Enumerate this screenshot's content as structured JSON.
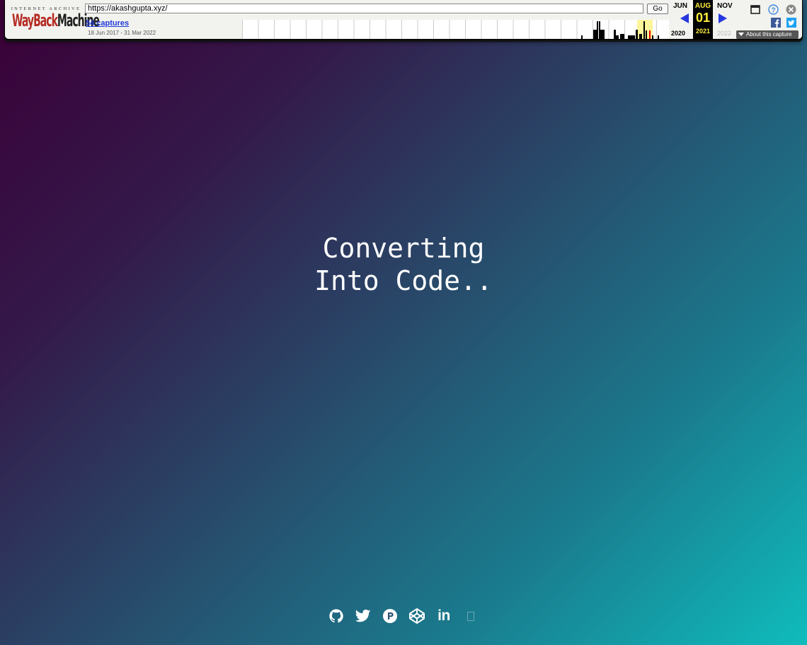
{
  "toolbar": {
    "logo_top": "INTERNET ARCHIVE",
    "logo_part1": "WayBack",
    "logo_part2": "Machine",
    "url_value": "https://akashgupta.xyz/",
    "go_label": "Go",
    "captures_link": "54 captures",
    "date_range": "18 Jun 2017 - 31 Mar 2022",
    "prev_month": "JUN",
    "current_month": "AUG",
    "next_month": "NOV",
    "current_day": "01",
    "prev_year": "2020",
    "current_year": "2021",
    "next_year": "2022",
    "about_label": "About this capture",
    "highlight_color": "#fff59a",
    "accent_color": "#ffef3d"
  },
  "main": {
    "loading_line1": "Converting",
    "loading_line2": "Into Code..",
    "background_gradient": [
      "#3a0037",
      "#284a6a",
      "#0fbcbc"
    ]
  },
  "socials": [
    {
      "icon": "github-icon"
    },
    {
      "icon": "twitter-icon"
    },
    {
      "icon": "producthunt-icon"
    },
    {
      "icon": "codepen-icon"
    },
    {
      "icon": "linkedin-icon",
      "label": "in"
    },
    {
      "icon": "missing-glyph-icon"
    }
  ]
}
